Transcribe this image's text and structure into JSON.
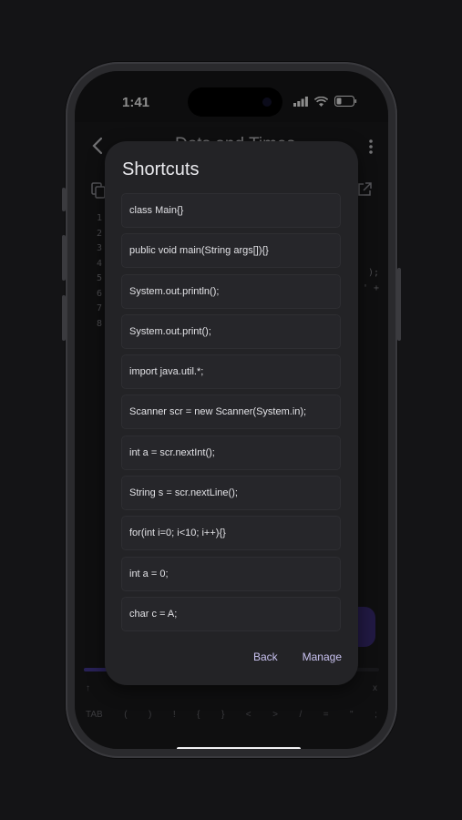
{
  "status": {
    "time": "1:41"
  },
  "app": {
    "title": "Dots and Times",
    "line_numbers": [
      "1",
      "2",
      "3",
      "4",
      "5",
      "6",
      "7",
      "8"
    ],
    "code_peek": [
      ");",
      "' +"
    ],
    "keyboard_row1": [
      "↑",
      "",
      "x"
    ],
    "keyboard_row2": [
      "TAB",
      "(",
      ")",
      "!",
      "{",
      "}",
      "<",
      ">",
      "/",
      "=",
      "\"",
      ";"
    ]
  },
  "dialog": {
    "title": "Shortcuts",
    "items": [
      "class Main{}",
      "public void main(String args[]){}",
      "System.out.println();",
      "System.out.print();",
      "import java.util.*;",
      "Scanner scr = new Scanner(System.in);",
      "int a = scr.nextInt();",
      "String s = scr.nextLine();",
      "for(int i=0; i<10; i++){}",
      "int a = 0;",
      "char c = A;"
    ],
    "back_label": "Back",
    "manage_label": "Manage"
  },
  "colors": {
    "accent": "#c9c2f0",
    "dialog_bg": "#232326",
    "fab": "#3d2f7a"
  }
}
